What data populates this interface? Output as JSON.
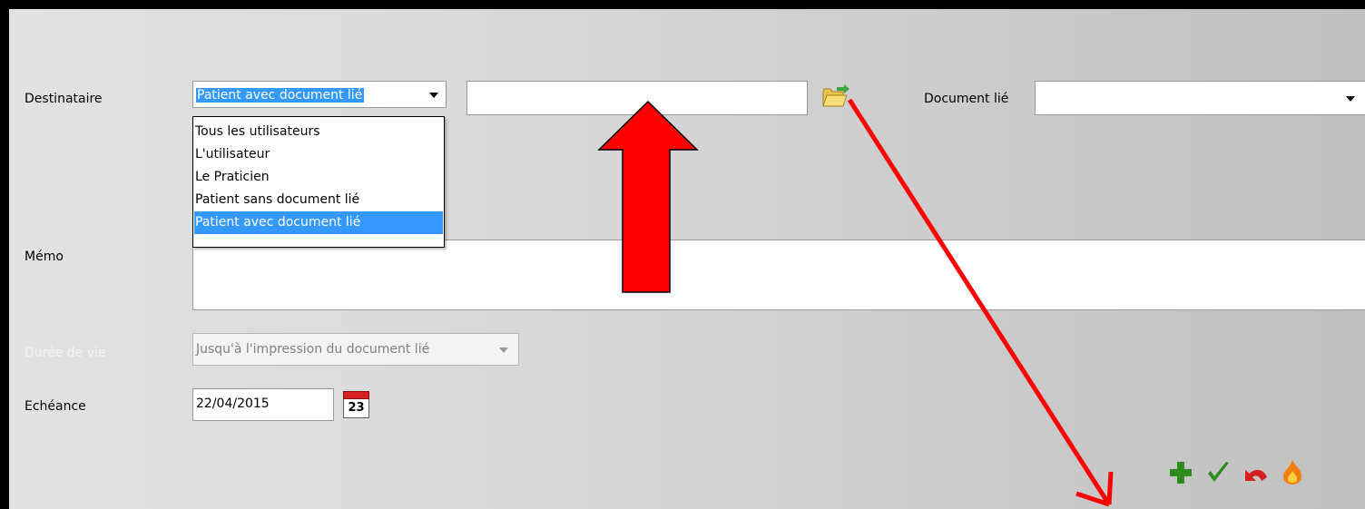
{
  "form": {
    "destinataire": {
      "label": "Destinataire",
      "selected": "Patient avec document lié",
      "options": [
        "Tous les utilisateurs",
        "L'utilisateur",
        "Le Praticien",
        "Patient sans document lié",
        "Patient avec document lié"
      ],
      "patient_value": ""
    },
    "document_lie": {
      "label": "Document lié",
      "value": ""
    },
    "memo": {
      "label": "Mémo",
      "value": ""
    },
    "duree_de_vie": {
      "label": "Durée de vie",
      "value": "Jusqu'à l'impression du document lié"
    },
    "echeance": {
      "label": "Echéance",
      "value": "22/04/2015",
      "calendar_day": "23"
    }
  },
  "toolbar": {
    "icons": [
      "add-icon",
      "validate-icon",
      "undo-icon",
      "delete-icon"
    ]
  },
  "colors": {
    "selection": "#3399ff",
    "annotation_arrow": "#ff0000",
    "add": "#2e8b1e",
    "validate": "#2e8b1e",
    "undo": "#d42020",
    "flame": "#f08010"
  }
}
